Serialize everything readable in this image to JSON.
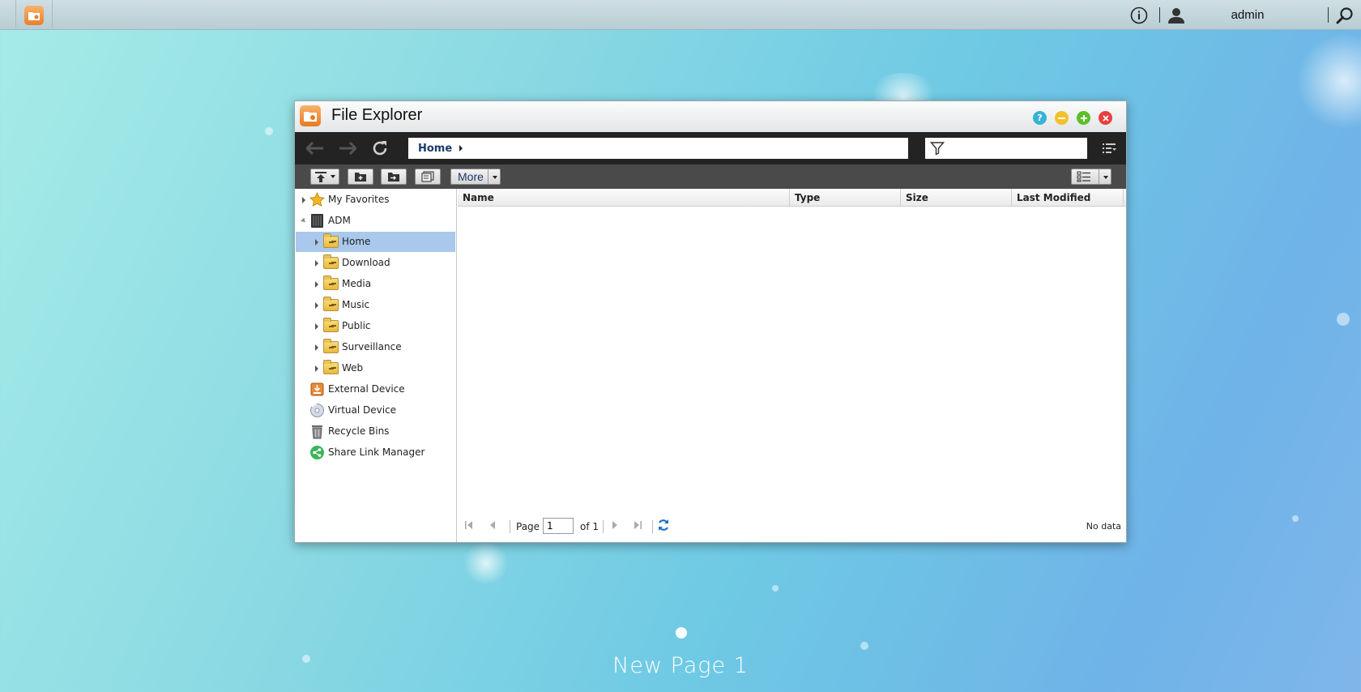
{
  "topbar": {
    "username": "admin",
    "icons": [
      "file-explorer-app-icon",
      "info-icon",
      "user-icon",
      "search-icon"
    ]
  },
  "window": {
    "title": "File Explorer",
    "controls": [
      "help",
      "minimize",
      "maximize",
      "close"
    ],
    "control_colors": {
      "help": "#37b3d6",
      "minimize": "#f3c12c",
      "maximize": "#5cbf2a",
      "close": "#e8413e"
    }
  },
  "navbar": {
    "breadcrumb": [
      "Home"
    ],
    "filter_placeholder": ""
  },
  "toolbar": {
    "more_label": "More"
  },
  "tree": {
    "items": [
      {
        "label": "My Favorites",
        "icon": "star-icon",
        "level": 0,
        "expander": "collapsed"
      },
      {
        "label": "ADM",
        "icon": "nas-icon",
        "level": 0,
        "expander": "expanded"
      },
      {
        "label": "Home",
        "icon": "folder-icon",
        "level": 1,
        "expander": "collapsed",
        "selected": true
      },
      {
        "label": "Download",
        "icon": "folder-icon",
        "level": 1,
        "expander": "collapsed"
      },
      {
        "label": "Media",
        "icon": "folder-icon",
        "level": 1,
        "expander": "collapsed"
      },
      {
        "label": "Music",
        "icon": "folder-icon",
        "level": 1,
        "expander": "collapsed"
      },
      {
        "label": "Public",
        "icon": "folder-icon",
        "level": 1,
        "expander": "collapsed"
      },
      {
        "label": "Surveillance",
        "icon": "folder-icon",
        "level": 1,
        "expander": "collapsed"
      },
      {
        "label": "Web",
        "icon": "folder-icon",
        "level": 1,
        "expander": "collapsed"
      },
      {
        "label": "External Device",
        "icon": "external-device-icon",
        "level": 0,
        "expander": "none"
      },
      {
        "label": "Virtual Device",
        "icon": "virtual-device-icon",
        "level": 0,
        "expander": "none"
      },
      {
        "label": "Recycle Bins",
        "icon": "recycle-bin-icon",
        "level": 0,
        "expander": "none"
      },
      {
        "label": "Share Link Manager",
        "icon": "share-link-icon",
        "level": 0,
        "expander": "none"
      }
    ]
  },
  "grid": {
    "columns": [
      "Name",
      "Type",
      "Size",
      "Last Modified"
    ],
    "rows": []
  },
  "pager": {
    "page_label": "Page",
    "current_page": "1",
    "of_label": "of 1",
    "status": "No data"
  },
  "desktop": {
    "page_name": "New Page 1"
  },
  "colors": {
    "selected_row": "#a9c8ec",
    "navbar": "#232323",
    "toolbar": "#4a4a4a",
    "accent_text": "#1b3a6b"
  }
}
